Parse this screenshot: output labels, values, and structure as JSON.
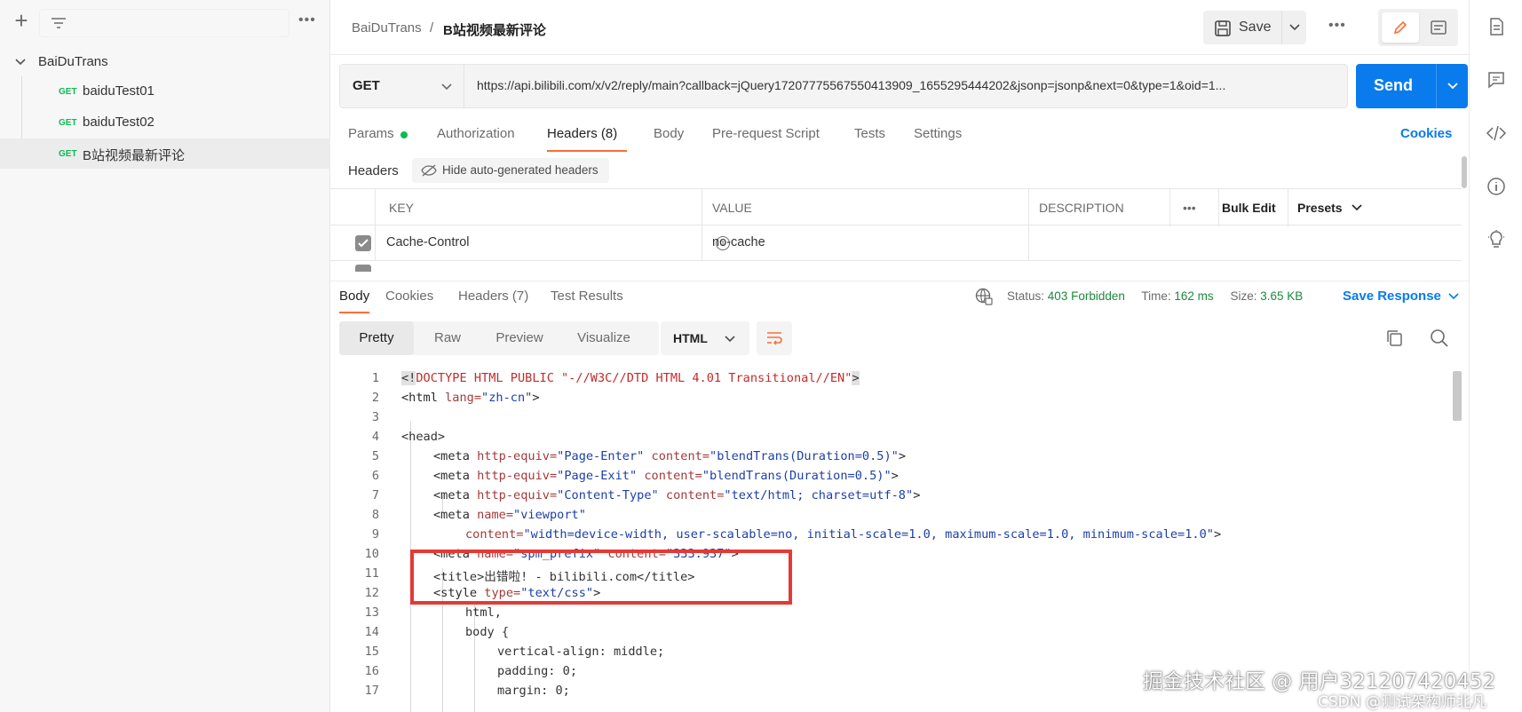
{
  "sidebar": {
    "more_icon": "more-icon",
    "collection": "BaiDuTrans",
    "requests": [
      {
        "method": "GET",
        "name": "baiduTest01"
      },
      {
        "method": "GET",
        "name": "baiduTest02"
      },
      {
        "method": "GET",
        "name": "B站视频最新评论"
      }
    ]
  },
  "breadcrumb": {
    "collection": "BaiDuTrans",
    "separator": "/",
    "request": "B站视频最新评论"
  },
  "toolbar": {
    "save_label": "Save",
    "more": "•••"
  },
  "request": {
    "method": "GET",
    "url": "https://api.bilibili.com/x/v2/reply/main?callback=jQuery17207775567550413909_1655295444202&jsonp=jsonp&next=0&type=1&oid=1...",
    "send_label": "Send"
  },
  "request_tabs": {
    "params": "Params",
    "authorization": "Authorization",
    "headers": "Headers (8)",
    "body": "Body",
    "prerequest": "Pre-request Script",
    "tests": "Tests",
    "settings": "Settings",
    "cookies": "Cookies"
  },
  "headers_bar": {
    "label": "Headers",
    "hide_auto": "Hide auto-generated headers"
  },
  "headers_table": {
    "columns": {
      "key": "KEY",
      "value": "VALUE",
      "description": "DESCRIPTION",
      "more": "•••",
      "bulk_edit": "Bulk Edit",
      "presets": "Presets"
    },
    "rows": [
      {
        "key": "Cache-Control",
        "value": "no-cache",
        "description": ""
      }
    ]
  },
  "response_tabs": {
    "body": "Body",
    "cookies": "Cookies",
    "headers": "Headers (7)",
    "test_results": "Test Results"
  },
  "response_meta": {
    "status_label": "Status:",
    "status_value": "403 Forbidden",
    "time_label": "Time:",
    "time_value": "162 ms",
    "size_label": "Size:",
    "size_value": "3.65 KB",
    "save_response": "Save Response"
  },
  "format": {
    "modes": [
      "Pretty",
      "Raw",
      "Preview",
      "Visualize"
    ],
    "active": "Pretty",
    "language": "HTML"
  },
  "code_lines": [
    {
      "n": "1"
    },
    {
      "n": "2"
    },
    {
      "n": "3"
    },
    {
      "n": "4"
    },
    {
      "n": "5"
    },
    {
      "n": "6"
    },
    {
      "n": "7"
    },
    {
      "n": "8"
    },
    {
      "n": "9"
    },
    {
      "n": "10"
    },
    {
      "n": "11"
    },
    {
      "n": "12"
    },
    {
      "n": "13"
    },
    {
      "n": "14"
    },
    {
      "n": "15"
    },
    {
      "n": "16"
    },
    {
      "n": "17"
    }
  ],
  "code": {
    "l1_open": "<!",
    "l1_doctype": "DOCTYPE HTML PUBLIC \"-//W3C//DTD HTML 4.01 Transitional//EN\"",
    "l1_close": ">",
    "l2_open": "<html ",
    "l2_attr": "lang=",
    "l2_val": "\"zh-cn\"",
    "l2_close": ">",
    "l4": "<head>",
    "l5_tag": "<meta ",
    "l5_a1": "http-equiv=",
    "l5_v1": "\"Page-Enter\"",
    "l5_a2": " content=",
    "l5_v2": "\"blendTrans(Duration=0.5)\"",
    "l5_end": ">",
    "l6_tag": "<meta ",
    "l6_a1": "http-equiv=",
    "l6_v1": "\"Page-Exit\"",
    "l6_a2": " content=",
    "l6_v2": "\"blendTrans(Duration=0.5)\"",
    "l6_end": ">",
    "l7_tag": "<meta ",
    "l7_a1": "http-equiv=",
    "l7_v1": "\"Content-Type\"",
    "l7_a2": " content=",
    "l7_v2": "\"text/html; charset=utf-8\"",
    "l7_end": ">",
    "l8_tag": "<meta ",
    "l8_a1": "name=",
    "l8_v1": "\"viewport\"",
    "l9_a": "content=",
    "l9_v": "\"width=device-width, user-scalable=no, initial-scale=1.0, maximum-scale=1.0, minimum-scale=1.0\"",
    "l9_end": ">",
    "l10_tag": "<meta ",
    "l10_a1": "name=",
    "l10_v1": "\"spm_prefix\"",
    "l10_a2": " content=",
    "l10_v2": "\"333.937\"",
    "l10_end": ">",
    "l11": "<title>出错啦! - bilibili.com</title>",
    "l12_tag": "<style ",
    "l12_a": "type=",
    "l12_v": "\"text/css\"",
    "l12_end": ">",
    "l13": "html,",
    "l14": "body {",
    "l15": "vertical-align: middle;",
    "l16": "padding: 0;",
    "l17": "margin: 0;"
  },
  "watermark": {
    "line1": "掘金技术社区 @ 用户3212074204​52",
    "line2": "CSDN @测试架构师北凡"
  },
  "colors": {
    "accent_orange": "#ff6c37",
    "send_blue": "#097bed",
    "status_green": "#1b8a3c",
    "highlight_red": "#e53935"
  }
}
